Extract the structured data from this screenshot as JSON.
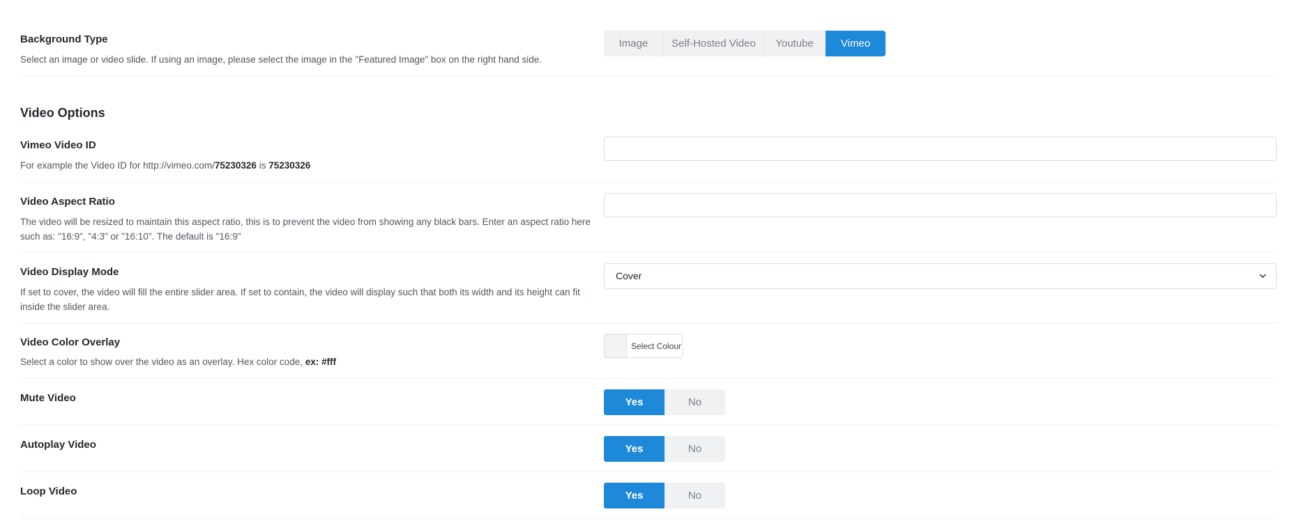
{
  "background_type": {
    "label": "Background Type",
    "description": "Select an image or video slide. If using an image, please select the image in the \"Featured Image\" box on the right hand side.",
    "options": [
      "Image",
      "Self-Hosted Video",
      "Youtube",
      "Vimeo"
    ],
    "selected": "Vimeo"
  },
  "video_options": {
    "title": "Video Options",
    "vimeo_id": {
      "label": "Vimeo Video ID",
      "desc_prefix": "For example the Video ID for http://vimeo.com/",
      "desc_id1": "75230326",
      "desc_mid": " is ",
      "desc_id2": "75230326",
      "value": ""
    },
    "aspect_ratio": {
      "label": "Video Aspect Ratio",
      "description": "The video will be resized to maintain this aspect ratio, this is to prevent the video from showing any black bars. Enter an aspect ratio here such as: \"16:9\", \"4:3\" or \"16:10\". The default is \"16:9\"",
      "value": ""
    },
    "display_mode": {
      "label": "Video Display Mode",
      "description": "If set to cover, the video will fill the entire slider area. If set to contain, the video will display such that both its width and its height can fit inside the slider area.",
      "selected": "Cover"
    },
    "color_overlay": {
      "label": "Video Color Overlay",
      "desc_prefix": "Select a color to show over the video as an overlay. Hex color code, ",
      "desc_example": "ex: #fff",
      "button_label": "Select Colour",
      "swatch_color": "#f2f3f4"
    },
    "mute": {
      "label": "Mute Video",
      "yes": "Yes",
      "no": "No",
      "value": "Yes"
    },
    "autoplay": {
      "label": "Autoplay Video",
      "yes": "Yes",
      "no": "No",
      "value": "Yes"
    },
    "loop": {
      "label": "Loop Video",
      "yes": "Yes",
      "no": "No",
      "value": "Yes"
    }
  },
  "colors": {
    "accent": "#1e88d9",
    "inactive_bg": "#f0f1f2"
  }
}
